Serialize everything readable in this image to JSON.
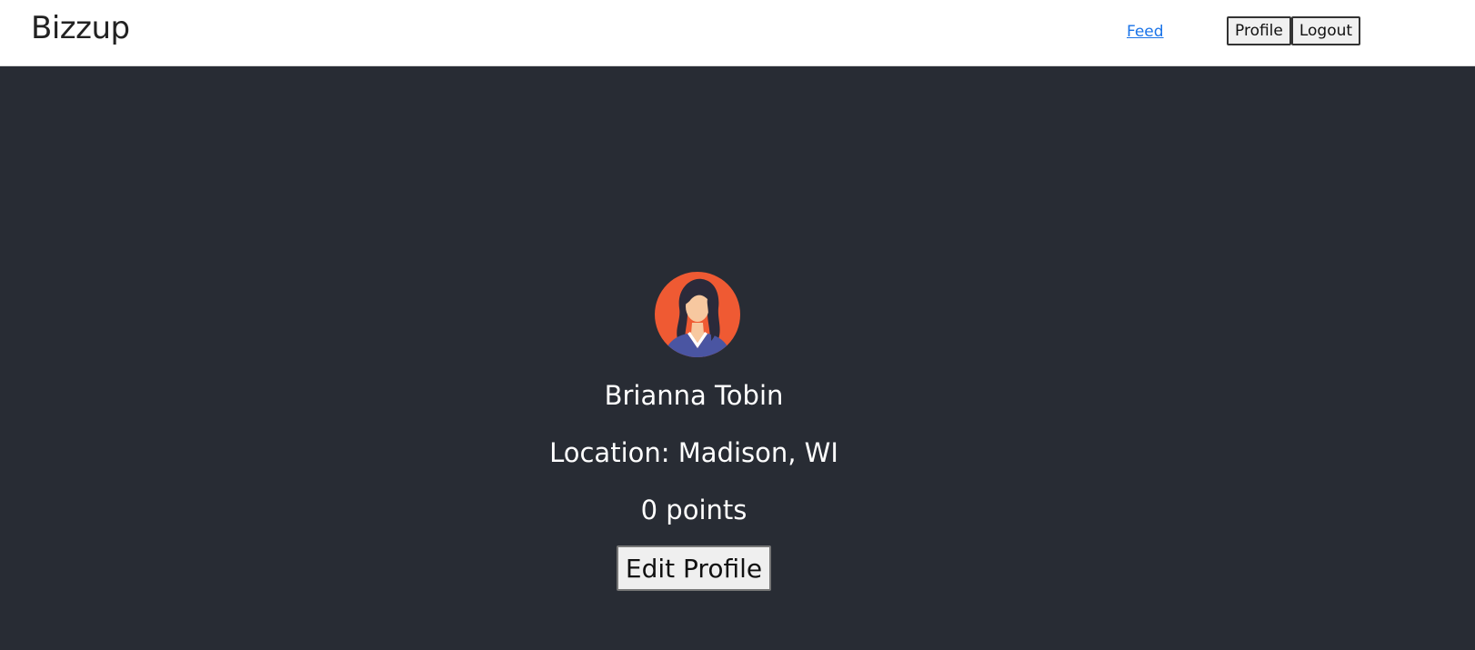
{
  "header": {
    "brand": "Bizzup",
    "feed_link": "Feed",
    "profile_button": "Profile",
    "logout_button": "Logout"
  },
  "profile": {
    "avatar_icon": "woman-avatar-icon",
    "name": "Brianna Tobin",
    "location": "Location: Madison, WI",
    "points": "0 points",
    "edit_button": "Edit Profile"
  },
  "colors": {
    "background": "#282c34",
    "header_background": "#ffffff",
    "link": "#1a73e8",
    "avatar_circle": "#ef5a33",
    "avatar_shirt": "#4a55a2"
  }
}
